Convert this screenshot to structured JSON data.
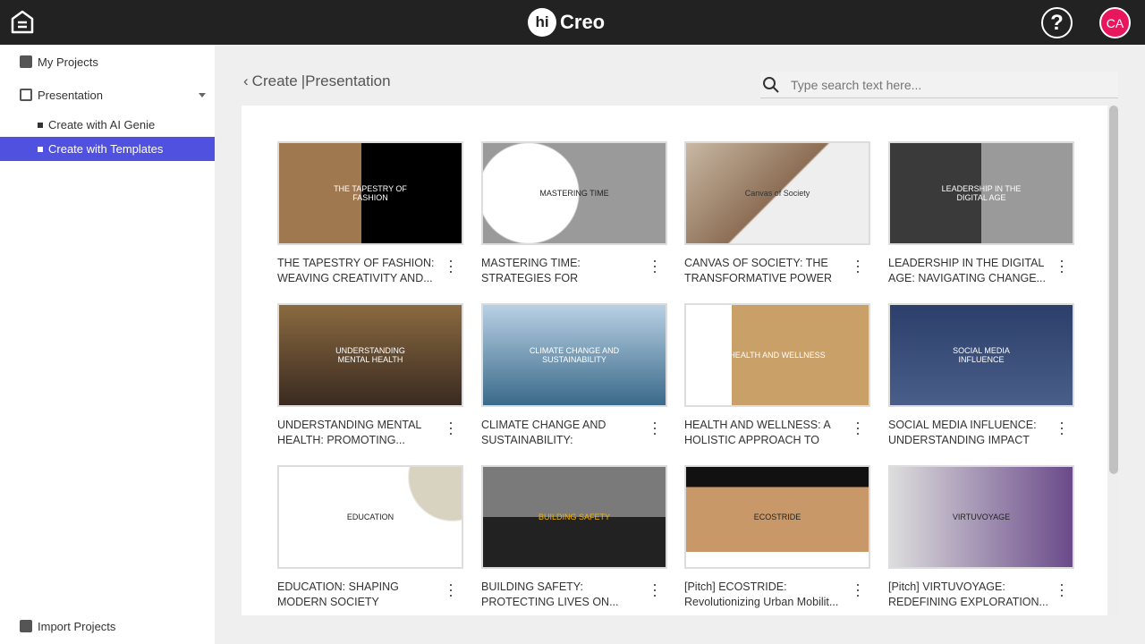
{
  "header": {
    "logo_hi": "hi",
    "logo_name": "Creo",
    "help": "?",
    "avatar": "CA"
  },
  "sidebar": {
    "my_projects": "My Projects",
    "presentation": "Presentation",
    "sub_items": [
      {
        "label": "Create with AI Genie",
        "active": false
      },
      {
        "label": "Create with Templates",
        "active": true
      }
    ],
    "import": "Import Projects"
  },
  "breadcrumb": {
    "root": "Create",
    "current": "|Presentation"
  },
  "search": {
    "placeholder": "Type search text here..."
  },
  "accent": "#5151e0",
  "templates": [
    {
      "title": "THE TAPESTRY OF FASHION: WEAVING CREATIVITY AND...",
      "thumb": "THE TAPESTRY OF FASHION",
      "bg": "linear-gradient(90deg,#a07850 0 45%,#000 45%)",
      "fg": "#fff"
    },
    {
      "title": "MASTERING TIME: STRATEGIES FOR ENHANCED PRODUCTIVI...",
      "thumb": "MASTERING TIME",
      "bg": "radial-gradient(circle at 25% 50%,#fff 0 34%,#9a9a9a 35%)",
      "fg": "#222"
    },
    {
      "title": "CANVAS OF SOCIETY: THE TRANSFORMATIVE POWER OF...",
      "thumb": "Canvas of Society",
      "bg": "linear-gradient(135deg,#c8b8a4,#8d6e55 50%,#eee 51%)",
      "fg": "#333"
    },
    {
      "title": "LEADERSHIP IN THE DIGITAL AGE: NAVIGATING CHANGE...",
      "thumb": "LEADERSHIP IN THE DIGITAL AGE",
      "bg": "linear-gradient(90deg,#3a3a3a 0 50%,#9a9a9a 50%)",
      "fg": "#fff"
    },
    {
      "title": "UNDERSTANDING MENTAL HEALTH: PROMOTING...",
      "thumb": "UNDERSTANDING MENTAL HEALTH",
      "bg": "linear-gradient(180deg,#8a6a40,#3a2a20)",
      "fg": "#fff"
    },
    {
      "title": "CLIMATE CHANGE AND SUSTAINABILITY: NAVIGATING...",
      "thumb": "CLIMATE CHANGE AND SUSTAINABILITY",
      "bg": "linear-gradient(180deg,#b8d0e4,#3a6a8a)",
      "fg": "#fff"
    },
    {
      "title": "HEALTH AND WELLNESS: A HOLISTIC APPROACH TO WEL...",
      "thumb": "HEALTH AND WELLNESS",
      "bg": "linear-gradient(90deg,#fff 0 25%,#c8a068 25%)",
      "fg": "#fff"
    },
    {
      "title": "SOCIAL MEDIA INFLUENCE: UNDERSTANDING IMPACT AN...",
      "thumb": "SOCIAL MEDIA INFLUENCE",
      "bg": "linear-gradient(180deg,#2b3f6a,#4a5e8a)",
      "fg": "#fff"
    },
    {
      "title": "EDUCATION: SHAPING MODERN SOCIETY",
      "thumb": "EDUCATION",
      "bg": "radial-gradient(circle at 95% 10%,#d8d2c0 0 22%,#fff 23%)",
      "fg": "#222"
    },
    {
      "title": "BUILDING SAFETY: PROTECTING LIVES ON...",
      "thumb": "BUILDING SAFETY",
      "bg": "linear-gradient(180deg,#7a7a7a 0 50%,#222 50%)",
      "fg": "#f0b400"
    },
    {
      "title": "[Pitch] ECOSTRIDE: Revolutionizing Urban Mobilit...",
      "thumb": "ECOSTRIDE",
      "bg": "linear-gradient(180deg,#111 0 20%,#c89868 20% 85%,#fff 85%)",
      "fg": "#222"
    },
    {
      "title": "[Pitch] VIRTUVOYAGE: REDEFINING EXPLORATION...",
      "thumb": "VIRTUVOYAGE",
      "bg": "linear-gradient(90deg,#ddd,#6a4a8a)",
      "fg": "#222"
    }
  ]
}
